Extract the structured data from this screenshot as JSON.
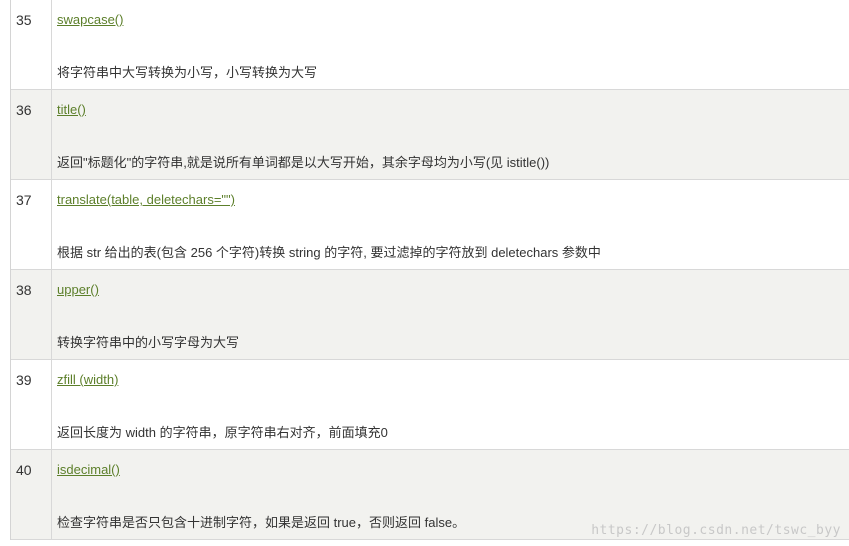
{
  "rows": [
    {
      "num": "35",
      "method": "swapcase()",
      "desc": "将字符串中大写转换为小写，小写转换为大写"
    },
    {
      "num": "36",
      "method": "title()",
      "desc": "返回\"标题化\"的字符串,就是说所有单词都是以大写开始，其余字母均为小写(见 istitle())"
    },
    {
      "num": "37",
      "method": "translate(table, deletechars=\"\")",
      "desc": "根据 str 给出的表(包含 256 个字符)转换 string 的字符, 要过滤掉的字符放到 deletechars 参数中"
    },
    {
      "num": "38",
      "method": "upper()",
      "desc": "转换字符串中的小写字母为大写"
    },
    {
      "num": "39",
      "method": "zfill (width)",
      "desc": "返回长度为 width 的字符串，原字符串右对齐，前面填充0"
    },
    {
      "num": "40",
      "method": "isdecimal()",
      "desc": "检查字符串是否只包含十进制字符，如果是返回 true，否则返回 false。"
    }
  ],
  "watermark": "https://blog.csdn.net/tswc_byy"
}
